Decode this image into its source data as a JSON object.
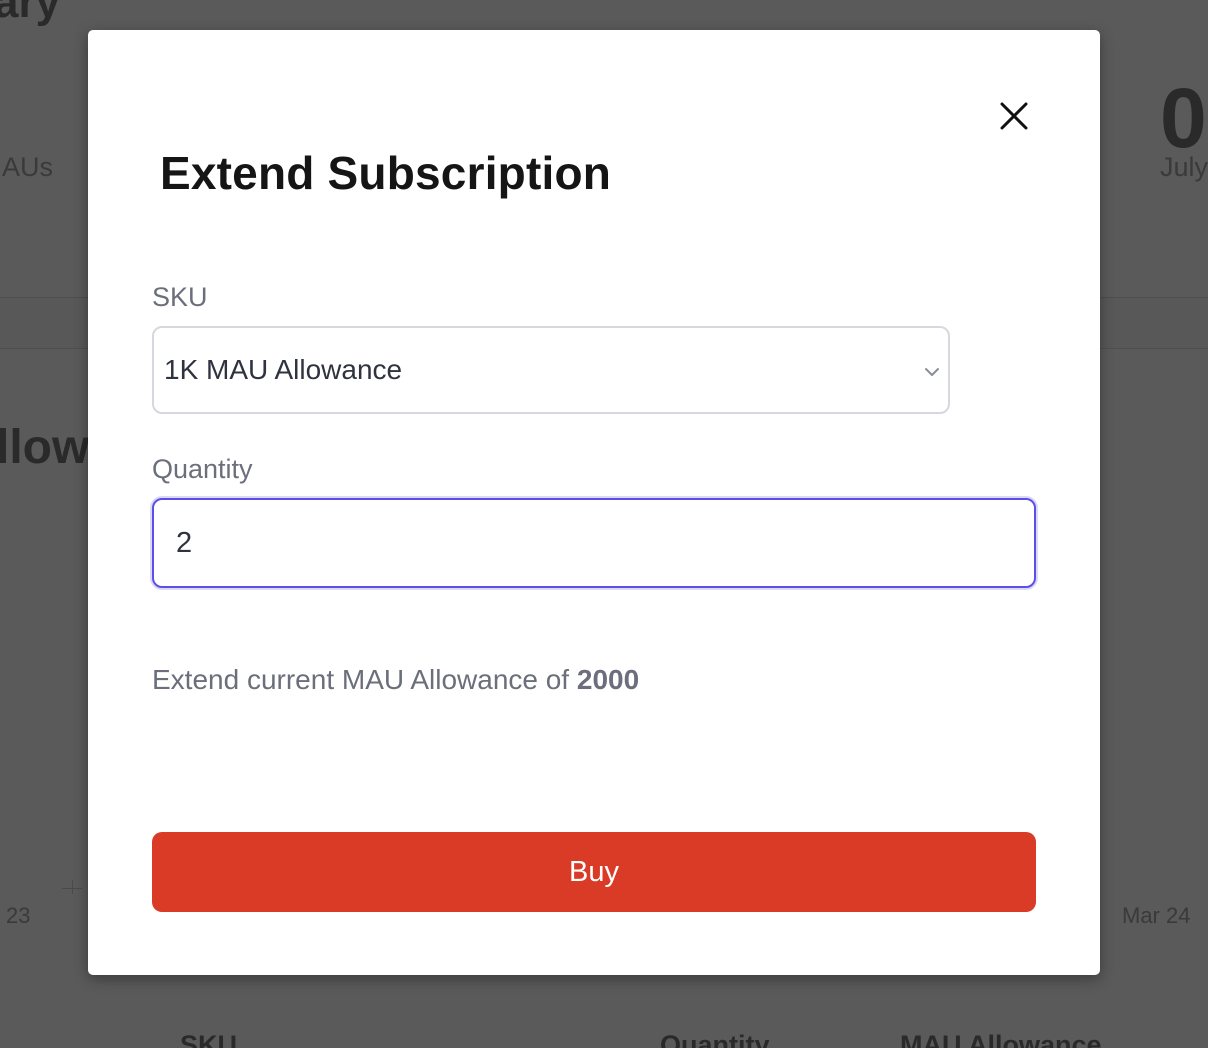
{
  "background": {
    "heading_fragment": "ary",
    "mau_label_fragment": "AUs",
    "stat_value_fragment": "0",
    "stat_caption_fragment": "July",
    "section_heading_fragment": "llow",
    "axis_left_label": "23",
    "axis_right_label": "Mar 24",
    "table_headers": [
      "SKU",
      "Quantity",
      "MAU Allowance"
    ]
  },
  "modal": {
    "title": "Extend Subscription",
    "close_icon": "close-icon",
    "sku_label": "SKU",
    "sku_selected": "1K MAU Allowance",
    "quantity_label": "Quantity",
    "quantity_value": "2",
    "info_prefix": "Extend current MAU Allowance of ",
    "info_value": "2000",
    "buy_label": "Buy"
  },
  "colors": {
    "overlay": "#5a5a5a",
    "focus_ring": "#5b4fe8",
    "buy_button": "#d93b26",
    "label_text": "#6b6f7b"
  }
}
